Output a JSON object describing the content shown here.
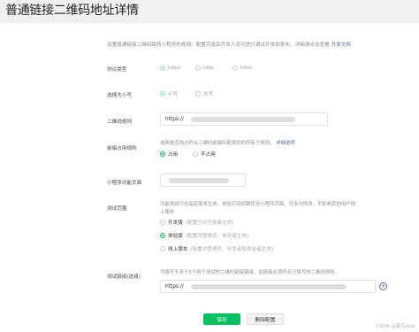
{
  "page": {
    "title": "普通链接二维码地址详情"
  },
  "description": {
    "text": "设置普通链接二维码跳转小程序的规则。配置完成后开发人员可进行调试开发和发布。详细请点击查看",
    "link": "开发文档"
  },
  "protocol": {
    "label": "协议类型",
    "options": [
      "https",
      "http",
      "html"
    ],
    "selected": "https"
  },
  "case": {
    "label": "选择大小写",
    "options": [
      "小写",
      "大写"
    ],
    "selected": "小写"
  },
  "qr_rule": {
    "label": "二维码规则",
    "value": "https://"
  },
  "prefix": {
    "label": "前缀占用规则",
    "hint": "选择是否独占符合二维码前缀匹配规则的所有子规则。",
    "hint_link": "详细说明",
    "options": [
      "占用",
      "不占用"
    ],
    "selected": "占用"
  },
  "page_func": {
    "label": "小程序功能页面"
  },
  "test_scope": {
    "label": "测试范围",
    "hint_lines": [
      "功能测试只在指定版本生效，体验打码码跳转至小程序页面，可多次修改，不影响其他用户线",
      "上服务"
    ],
    "options": [
      {
        "name": "开发版",
        "note": "(配置只对开发者生效)"
      },
      {
        "name": "体验版",
        "note": "(配置对管理员、体验者生效)"
      },
      {
        "name": "线上版本",
        "note": "(配置对管理员、开发者和体验者生效)"
      }
    ],
    "selected": "体验版"
  },
  "test_link": {
    "label": "测试链接(选填)",
    "hint": "可填写不多于5个用于测试的二维码链接链接，此链接必须符合已填写的二维码规则。",
    "value": "https://"
  },
  "buttons": {
    "save": "保存",
    "delete": "删除配置"
  },
  "watermark": "CSDN @晨鸟Jady",
  "colors": {
    "accent": "#07c160",
    "link": "#576b95"
  }
}
